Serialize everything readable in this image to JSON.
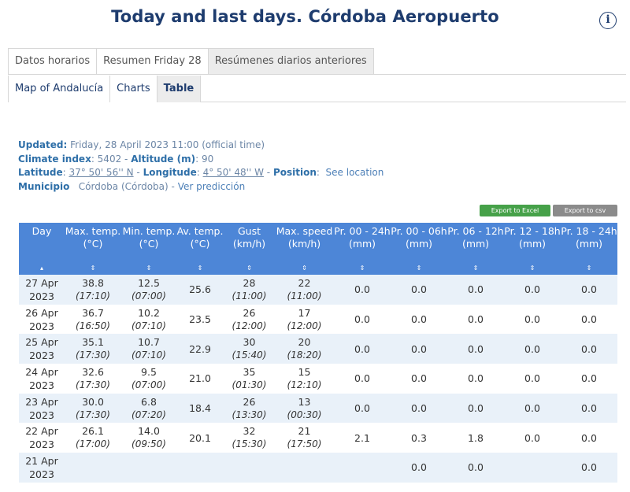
{
  "header": {
    "title": "Today and last days. Córdoba Aeropuerto",
    "info_glyph": "i"
  },
  "tabs_primary": [
    {
      "label": "Datos horarios",
      "active": false
    },
    {
      "label": "Resumen Friday 28",
      "active": false
    },
    {
      "label": "Resúmenes diarios anteriores",
      "active": true
    }
  ],
  "tabs_secondary": [
    {
      "label": "Map of Andalucía",
      "active": false
    },
    {
      "label": "Charts",
      "active": false
    },
    {
      "label": "Table",
      "active": true
    }
  ],
  "station": {
    "updated_label": "Updated:",
    "updated_value": "Friday, 28 April 2023 11:00 (official time)",
    "climate_label": "Climate index",
    "climate_value": ": 5402 -",
    "altitude_label": "Altitude (m)",
    "altitude_value": ": 90",
    "latitude_label": "Latitude",
    "latitude_value": "37° 50' 56'' N",
    "longitude_label": "Longitude",
    "longitude_value": "4° 50' 48'' W",
    "position_label": "Position",
    "position_link": "See location",
    "municipio_label": "Municipio",
    "municipio_value": "Córdoba (Córdoba) -",
    "prediction_link": "Ver predicción"
  },
  "exports": {
    "excel_label": "Export to Excel",
    "csv_label": "Export to csv"
  },
  "table": {
    "columns": [
      {
        "l1": "Day",
        "l2": "",
        "sort": "▴"
      },
      {
        "l1": "Max. temp.",
        "l2": "(°C)",
        "sort": "⇕"
      },
      {
        "l1": "Min. temp.",
        "l2": "(°C)",
        "sort": "⇕"
      },
      {
        "l1": "Av. temp.",
        "l2": "(°C)",
        "sort": "⇕"
      },
      {
        "l1": "Gust",
        "l2": "(km/h)",
        "sort": "⇕"
      },
      {
        "l1": "Max. speed",
        "l2": "(km/h)",
        "sort": "⇕"
      },
      {
        "l1": "Pr. 00 - 24h",
        "l2": "(mm)",
        "sort": "⇕"
      },
      {
        "l1": "Pr. 00 - 06h",
        "l2": "(mm)",
        "sort": "⇕"
      },
      {
        "l1": "Pr. 06 - 12h",
        "l2": "(mm)",
        "sort": "⇕"
      },
      {
        "l1": "Pr. 12 - 18h",
        "l2": "(mm)",
        "sort": "⇕"
      },
      {
        "l1": "Pr. 18 - 24h",
        "l2": "(mm)",
        "sort": "⇕"
      }
    ],
    "rows": [
      {
        "day1": "27 Apr",
        "day2": "2023",
        "max": "38.8",
        "max_t": "(17:10)",
        "min": "12.5",
        "min_t": "(07:00)",
        "avg": "25.6",
        "gust": "28",
        "gust_t": "(11:00)",
        "speed": "22",
        "speed_t": "(11:00)",
        "p24": "0.0",
        "p06": "0.0",
        "p12": "0.0",
        "p18": "0.0",
        "p2424": "0.0"
      },
      {
        "day1": "26 Apr",
        "day2": "2023",
        "max": "36.7",
        "max_t": "(16:50)",
        "min": "10.2",
        "min_t": "(07:10)",
        "avg": "23.5",
        "gust": "26",
        "gust_t": "(12:00)",
        "speed": "17",
        "speed_t": "(12:00)",
        "p24": "0.0",
        "p06": "0.0",
        "p12": "0.0",
        "p18": "0.0",
        "p2424": "0.0"
      },
      {
        "day1": "25 Apr",
        "day2": "2023",
        "max": "35.1",
        "max_t": "(17:30)",
        "min": "10.7",
        "min_t": "(07:10)",
        "avg": "22.9",
        "gust": "30",
        "gust_t": "(15:40)",
        "speed": "20",
        "speed_t": "(18:20)",
        "p24": "0.0",
        "p06": "0.0",
        "p12": "0.0",
        "p18": "0.0",
        "p2424": "0.0"
      },
      {
        "day1": "24 Apr",
        "day2": "2023",
        "max": "32.6",
        "max_t": "(17:30)",
        "min": "9.5",
        "min_t": "(07:00)",
        "avg": "21.0",
        "gust": "35",
        "gust_t": "(01:30)",
        "speed": "15",
        "speed_t": "(12:10)",
        "p24": "0.0",
        "p06": "0.0",
        "p12": "0.0",
        "p18": "0.0",
        "p2424": "0.0"
      },
      {
        "day1": "23 Apr",
        "day2": "2023",
        "max": "30.0",
        "max_t": "(17:30)",
        "min": "6.8",
        "min_t": "(07:20)",
        "avg": "18.4",
        "gust": "26",
        "gust_t": "(13:30)",
        "speed": "13",
        "speed_t": "(00:30)",
        "p24": "0.0",
        "p06": "0.0",
        "p12": "0.0",
        "p18": "0.0",
        "p2424": "0.0"
      },
      {
        "day1": "22 Apr",
        "day2": "2023",
        "max": "26.1",
        "max_t": "(17:00)",
        "min": "14.0",
        "min_t": "(09:50)",
        "avg": "20.1",
        "gust": "32",
        "gust_t": "(15:30)",
        "speed": "21",
        "speed_t": "(17:50)",
        "p24": "2.1",
        "p06": "0.3",
        "p12": "1.8",
        "p18": "0.0",
        "p2424": "0.0"
      },
      {
        "day1": "21 Apr",
        "day2": "2023",
        "max": "",
        "max_t": "",
        "min": "",
        "min_t": "",
        "avg": "",
        "gust": "",
        "gust_t": "",
        "speed": "",
        "speed_t": "",
        "p24": "",
        "p06": "0.0",
        "p12": "0.0",
        "p18": "",
        "p2424": "0.0"
      }
    ]
  }
}
